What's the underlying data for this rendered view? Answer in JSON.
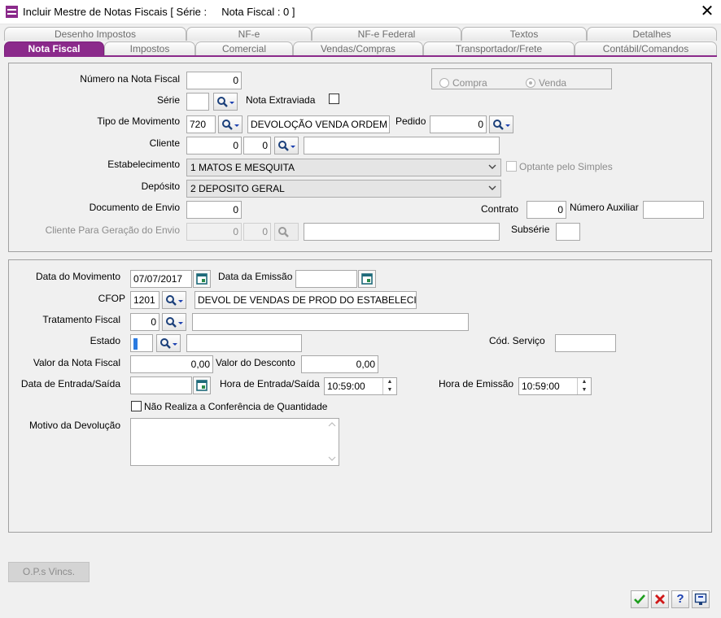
{
  "window": {
    "title": "Incluir Mestre de Notas Fiscais [ Série :     Nota Fiscal : 0 ]"
  },
  "colors": {
    "tab_active": "#8b2a8b",
    "panel": "#f0f0f0",
    "ok": "#1e9e1e",
    "cancel": "#d01818",
    "help": "#1a3fb0"
  },
  "tabs_back": [
    "Desenho Impostos",
    "NF-e",
    "NF-e Federal",
    "Textos",
    "Detalhes"
  ],
  "tabs_front": [
    "Nota Fiscal",
    "Impostos",
    "Comercial",
    "Vendas/Compras",
    "Transportador/Frete",
    "Contábil/Comandos"
  ],
  "section1": {
    "numero_label": "Número na Nota Fiscal",
    "numero_value": "0",
    "tipo_operacao": {
      "compra": "Compra",
      "venda": "Venda",
      "selected": "Venda"
    },
    "serie_label": "Série",
    "serie_value": "",
    "nota_extraviada_label": "Nota Extraviada",
    "nota_extraviada_checked": false,
    "tipo_mov_label": "Tipo de Movimento",
    "tipo_mov_code": "720",
    "tipo_mov_desc": "DEVOLOÇÃO VENDA ORDEM",
    "pedido_label": "Pedido",
    "pedido_value": "0",
    "cliente_label": "Cliente",
    "cliente_code": "0",
    "cliente_code2": "0",
    "cliente_name": "",
    "estab_label": "Estabelecimento",
    "estab_value": "1 MATOS E MESQUITA",
    "optante_label": "Optante pelo Simples",
    "deposito_label": "Depósito",
    "deposito_value": "2 DEPOSITO GERAL",
    "doc_envio_label": "Documento de Envio",
    "doc_envio_value": "0",
    "contrato_label": "Contrato",
    "contrato_value": "0",
    "num_aux_label": "Número Auxiliar",
    "num_aux_value": "",
    "cliente_ger_label": "Cliente Para Geração do Envio",
    "cliente_ger_code": "0",
    "cliente_ger_code2": "0",
    "cliente_ger_name": "",
    "subserie_label": "Subsérie",
    "subserie_value": ""
  },
  "section2": {
    "data_mov_label": "Data do Movimento",
    "data_mov_value": "07/07/2017",
    "data_emissao_label": "Data da Emissão",
    "data_emissao_value": "",
    "cfop_label": "CFOP",
    "cfop_code": "1201",
    "cfop_desc": "DEVOL DE VENDAS DE PROD DO ESTABELECIMEN",
    "trat_fiscal_label": "Tratamento Fiscal",
    "trat_fiscal_code": "0",
    "trat_fiscal_desc": "",
    "estado_label": "Estado",
    "estado_code": "",
    "estado_desc": "",
    "cod_servico_label": "Cód. Serviço",
    "cod_servico_value": "",
    "valor_nf_label": "Valor da Nota Fiscal",
    "valor_nf_value": "0,00",
    "valor_desc_label": "Valor do Desconto",
    "valor_desc_value": "0,00",
    "data_es_label": "Data de Entrada/Saída",
    "data_es_value": "",
    "hora_es_label": "Hora de Entrada/Saída",
    "hora_es_value": "10:59:00",
    "hora_emissao_label": "Hora de Emissão",
    "hora_emissao_value": "10:59:00",
    "nao_realiza_label": "Não Realiza a Conferência de Quantidade",
    "nao_realiza_checked": false,
    "motivo_label": "Motivo da Devolução",
    "motivo_value": ""
  },
  "buttons": {
    "ops_vincs": "O.P.s Vincs.",
    "help": "?"
  }
}
